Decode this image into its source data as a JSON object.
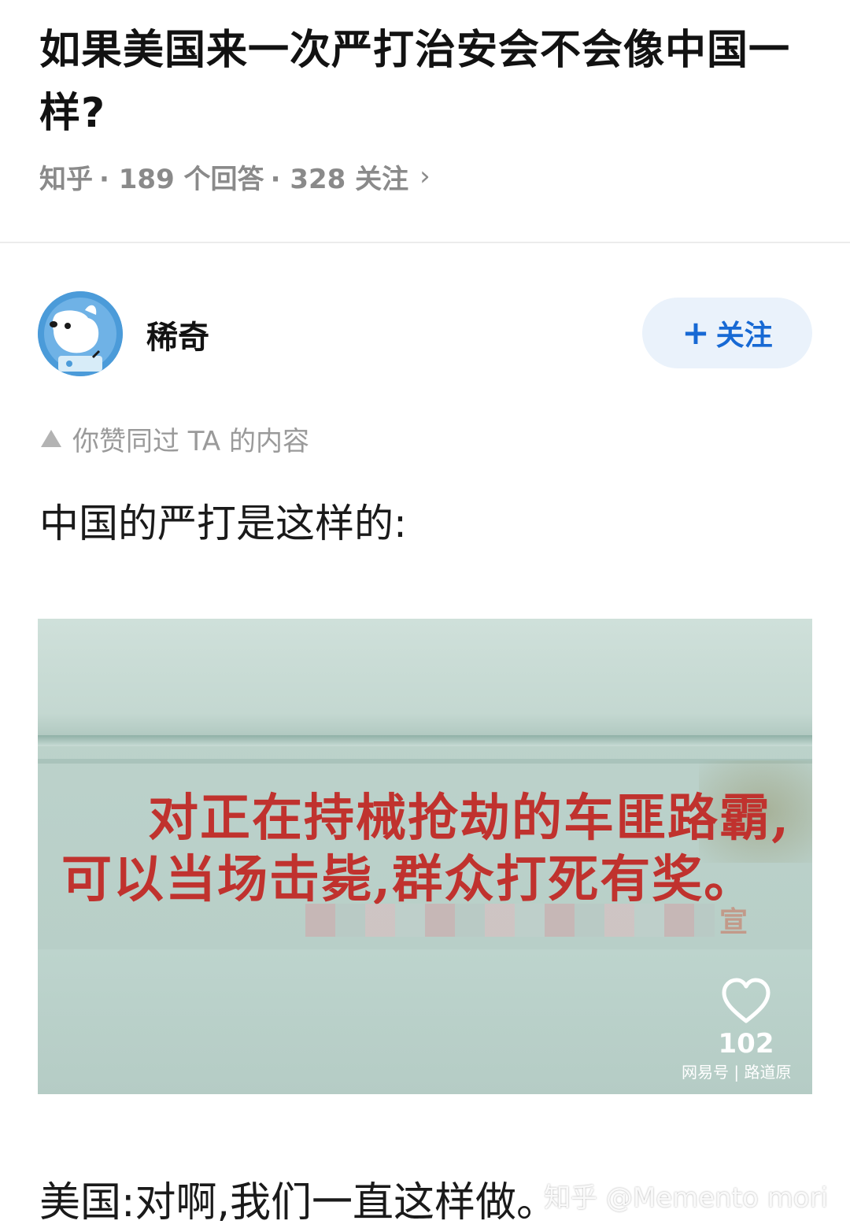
{
  "question": {
    "title": "如果美国来一次严打治安会不会像中国一样?",
    "meta_source": "知乎",
    "meta_answers": "· 189 个回答",
    "meta_follows": "· 328 关注"
  },
  "answer": {
    "author_name": "稀奇",
    "follow_label": "关注",
    "liked_note": "你赞同过 TA 的内容",
    "paragraph_1": "中国的严打是这样的:",
    "paragraph_2": "美国:对啊,我们一直这样做。"
  },
  "photo": {
    "sign_line_1": "对正在持械抢劫的车匪路霸,",
    "sign_line_2": "可以当场击毙,群众打死有奖。",
    "sign_tail": "宣",
    "like_count": "102",
    "source_watermark": "网易号 | 路道原"
  },
  "watermark": "知乎 @Memento mori",
  "icons": {
    "chevron": "chevron-right-icon",
    "plus": "plus-icon",
    "triangle": "upvote-triangle-icon",
    "heart": "heart-outline-icon"
  },
  "colors": {
    "accent": "#1769d4",
    "follow_bg": "#eaf2fb",
    "sign_red": "#c0322e",
    "muted": "#8a8a8a"
  }
}
